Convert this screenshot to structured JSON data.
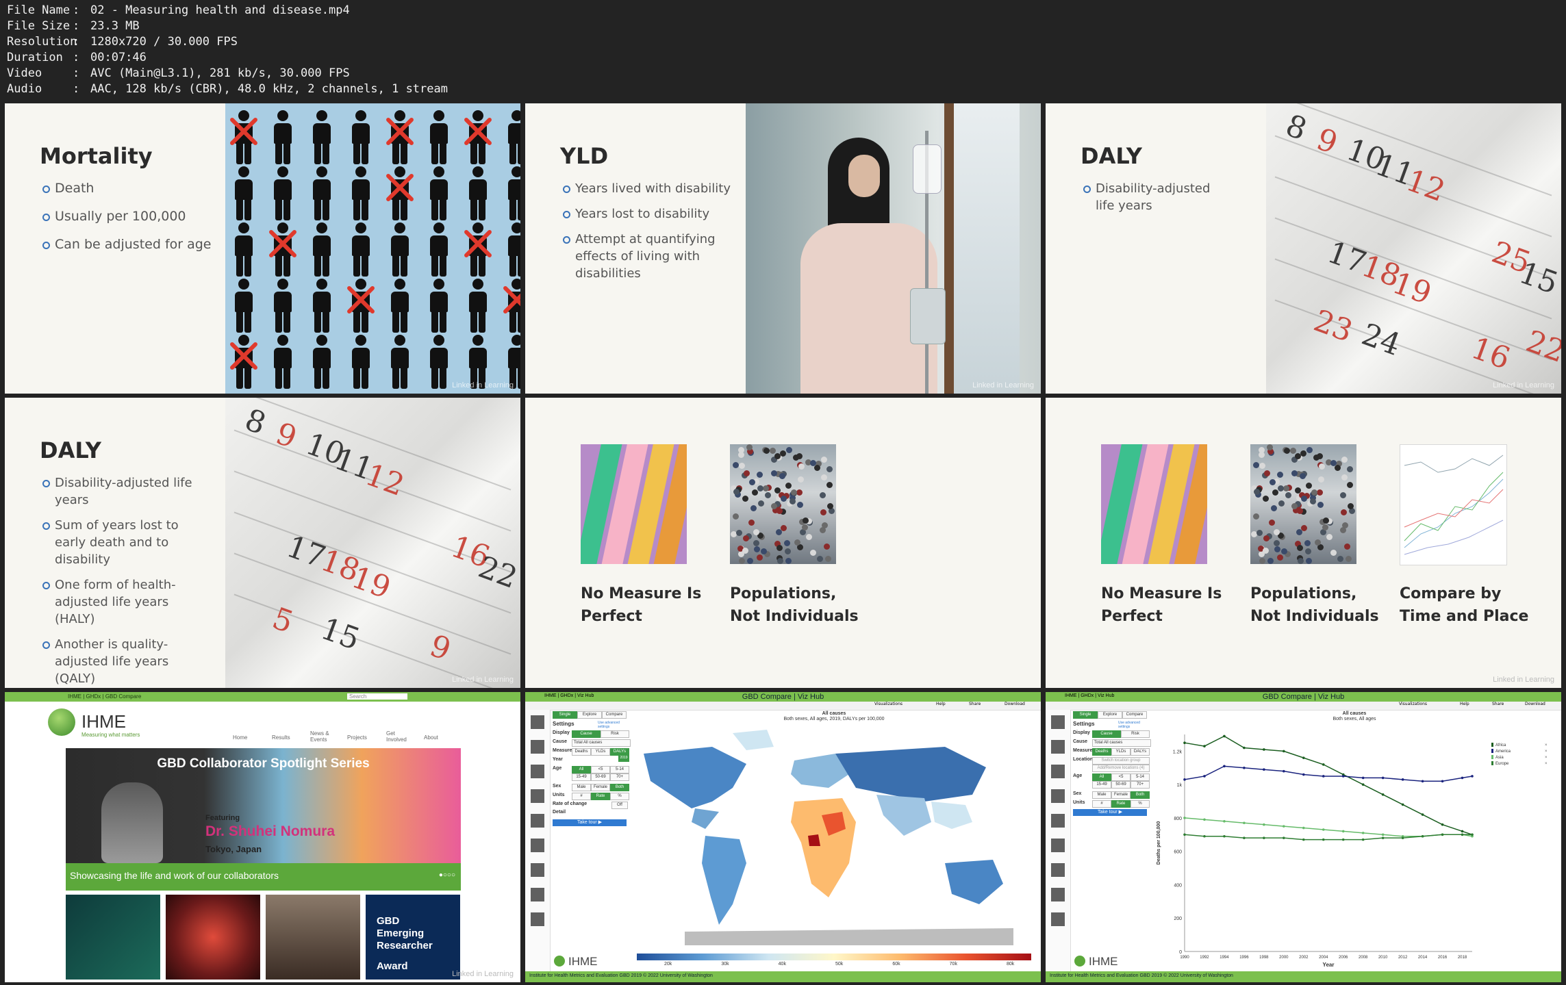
{
  "file_info": [
    {
      "key": "File Name",
      "value": "02 - Measuring health and disease.mp4"
    },
    {
      "key": "File Size",
      "value": "23.3 MB"
    },
    {
      "key": "Resolution",
      "value": "1280x720 / 30.000 FPS"
    },
    {
      "key": "Duration",
      "value": "00:07:46"
    },
    {
      "key": "Video",
      "value": "AVC (Main@L3.1), 281 kb/s, 30.000 FPS"
    },
    {
      "key": "Audio",
      "value": "AAC, 128 kb/s (CBR), 48.0 kHz, 2 channels, 1 stream"
    }
  ],
  "separator": ":",
  "watermark": "Linked in Learning",
  "slides": {
    "mortality": {
      "title": "Mortality",
      "bullets": [
        "Death",
        "Usually per 100,000",
        "Can be adjusted for age"
      ]
    },
    "yld": {
      "title": "YLD",
      "bullets": [
        "Years lived with disability",
        "Years lost to disability",
        "Attempt at quantifying effects of living with disabilities"
      ]
    },
    "daly1": {
      "title": "DALY",
      "bullets": [
        "Disability-adjusted life years"
      ]
    },
    "daly2": {
      "title": "DALY",
      "bullets": [
        "Disability-adjusted life years",
        "Sum of years lost to early death and to disability",
        "One form of health-adjusted life years (HALY)",
        "Another is quality-adjusted life years (QALY)"
      ]
    },
    "captions_a": [
      "No Measure Is Perfect",
      "Populations, Not Individuals"
    ],
    "captions_b": [
      "No Measure Is Perfect",
      "Populations, Not Individuals",
      "Compare by Time and Place"
    ]
  },
  "calendar_numbers_a": [
    "8",
    "9",
    "10",
    "11",
    "12",
    "17",
    "18",
    "19",
    "23",
    "24",
    "25",
    "15",
    "16",
    "22"
  ],
  "calendar_numbers_b": [
    "8",
    "9",
    "10",
    "11",
    "12",
    "17",
    "18",
    "19",
    "5",
    "15",
    "16",
    "22",
    "9"
  ],
  "ihme_site": {
    "topbar": "IHME | GHDx | GBD Compare",
    "search": "Search",
    "brand": "IHME",
    "tagline": "Measuring what matters",
    "nav": [
      "Home",
      "Results",
      "News & Events",
      "Projects",
      "Get Involved",
      "About"
    ],
    "banner_title": "GBD Collaborator Spotlight Series",
    "featuring": "Featuring",
    "name": "Dr. Shuhei Nomura",
    "location": "Tokyo, Japan",
    "strip": "Showcasing the life and work of our collaborators",
    "card4_lines": [
      "GBD",
      "Emerging",
      "Researcher",
      "Award"
    ]
  },
  "viz": {
    "title": "GBD Compare | Viz Hub",
    "topbar": "IHME | GHDx | Viz Hub",
    "menu": [
      "Visualizations",
      "Help",
      "Share",
      "Download"
    ],
    "tabs": [
      "Single",
      "Explore",
      "Compare"
    ],
    "settings_title": "Settings",
    "advanced": "Use advanced settings",
    "labels": [
      "Display",
      "Cause",
      "Measure",
      "Year",
      "Age",
      "Sex",
      "Units",
      "Rate of change",
      "Detail"
    ],
    "display_opts": [
      "Cause",
      "Risk"
    ],
    "cause_value": "Total All causes",
    "measure_opts": [
      "Deaths",
      "YLDs",
      "DALYs"
    ],
    "age_opts": [
      "All",
      "<5",
      "5-14",
      "15-49",
      "50-69",
      "70+"
    ],
    "sex_opts": [
      "Male",
      "Female",
      "Both"
    ],
    "unit_opts": [
      "#",
      "Rate",
      "%"
    ],
    "tour": "Take tour ▶",
    "footer": "Institute for Health Metrics and Evaluation    GBD 2019    © 2022 University of Washington",
    "locations_label": "Locations",
    "locations_values": [
      "Switch location group",
      "Add/Remove locations (4)"
    ],
    "year_badge": "2019",
    "off_label": "Off"
  },
  "map": {
    "title": "All causes",
    "subtitle": "Both sexes, All ages, 2019, DALYs per 100,000",
    "colorbar_ticks": [
      "20k",
      "30k",
      "40k",
      "50k",
      "60k",
      "70k",
      "80k"
    ]
  },
  "chart_data": {
    "type": "line",
    "title": "All causes",
    "subtitle": "Both sexes, All ages",
    "xlabel": "Year",
    "ylabel": "Deaths per 100,000",
    "x": [
      1990,
      1992,
      1994,
      1996,
      1998,
      2000,
      2002,
      2004,
      2006,
      2008,
      2010,
      2012,
      2014,
      2016,
      2018,
      2019
    ],
    "x_ticks": [
      "1990",
      "1992",
      "1994",
      "1996",
      "1998",
      "2000",
      "2002",
      "2004",
      "2006",
      "2008",
      "2010",
      "2012",
      "2014",
      "2016",
      "2018"
    ],
    "y_ticks": [
      "0",
      "200",
      "400",
      "600",
      "800",
      "1k",
      "1.2k"
    ],
    "ylim": [
      0,
      1300
    ],
    "legend": "top-right",
    "series": [
      {
        "name": "Africa",
        "color": "#1b5e20",
        "values": [
          1250,
          1230,
          1290,
          1220,
          1210,
          1200,
          1160,
          1120,
          1060,
          1000,
          940,
          880,
          820,
          760,
          720,
          700
        ]
      },
      {
        "name": "America",
        "color": "#1a237e",
        "values": [
          1030,
          1050,
          1110,
          1100,
          1090,
          1080,
          1060,
          1050,
          1050,
          1040,
          1040,
          1030,
          1020,
          1020,
          1040,
          1050
        ]
      },
      {
        "name": "Asia",
        "color": "#66bb6a",
        "values": [
          800,
          790,
          780,
          770,
          760,
          750,
          740,
          730,
          720,
          710,
          700,
          690,
          690,
          700,
          700,
          690
        ]
      },
      {
        "name": "Europe",
        "color": "#2e7d32",
        "values": [
          700,
          690,
          690,
          680,
          680,
          680,
          670,
          670,
          670,
          670,
          680,
          680,
          690,
          700,
          700,
          700
        ]
      }
    ]
  }
}
